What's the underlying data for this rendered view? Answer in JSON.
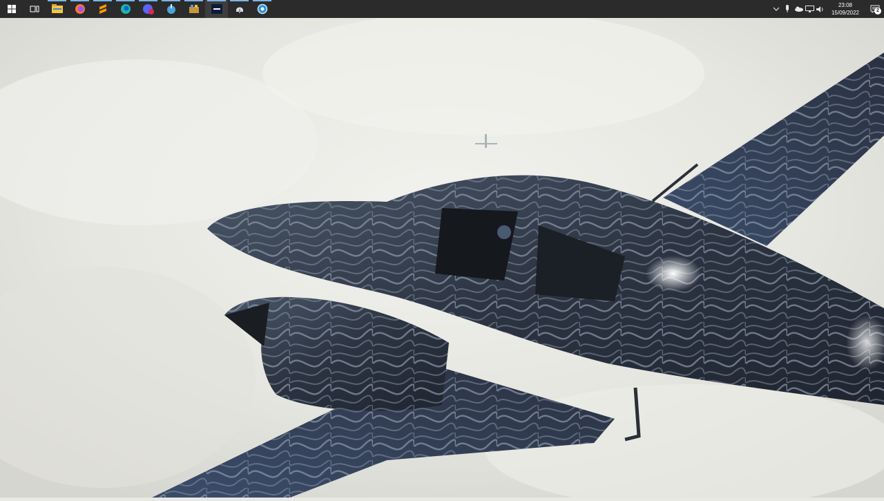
{
  "taskbar": {
    "apps": [
      {
        "name": "start-button",
        "icon": "windows-logo",
        "running": false,
        "active": false
      },
      {
        "name": "task-view-button",
        "icon": "task-view",
        "running": false,
        "active": false
      },
      {
        "name": "file-explorer",
        "icon": "folder",
        "running": true,
        "active": false
      },
      {
        "name": "firefox",
        "icon": "firefox",
        "running": true,
        "active": false
      },
      {
        "name": "sublime-text",
        "icon": "sublime",
        "running": true,
        "active": false
      },
      {
        "name": "edge",
        "icon": "edge",
        "running": true,
        "active": false
      },
      {
        "name": "chat-app",
        "icon": "chat",
        "badge": "99",
        "running": true,
        "active": false
      },
      {
        "name": "app-globe",
        "icon": "globe-download",
        "running": true,
        "active": false
      },
      {
        "name": "app-toolbox",
        "icon": "toolbox",
        "running": true,
        "active": false
      },
      {
        "name": "flight-simulator",
        "icon": "flight-sim",
        "running": true,
        "active": true
      },
      {
        "name": "app-helmet",
        "icon": "helmet",
        "running": true,
        "active": false
      },
      {
        "name": "app-sync",
        "icon": "sync-circle",
        "running": true,
        "active": false
      }
    ],
    "tray": {
      "icons": [
        "chevron-up-icon",
        "microphone-icon",
        "onedrive-cloud-icon",
        "network-icon",
        "volume-icon"
      ],
      "time": "23:08",
      "date": "15/09/2022",
      "notification_count": "2"
    }
  },
  "colors": {
    "taskbar_bg": "#2b2b2b",
    "running_indicator": "#7fb2e5",
    "sky": "#e9e9e4",
    "aircraft_body": "#3a4454",
    "aircraft_pattern": "#8a95a6"
  }
}
